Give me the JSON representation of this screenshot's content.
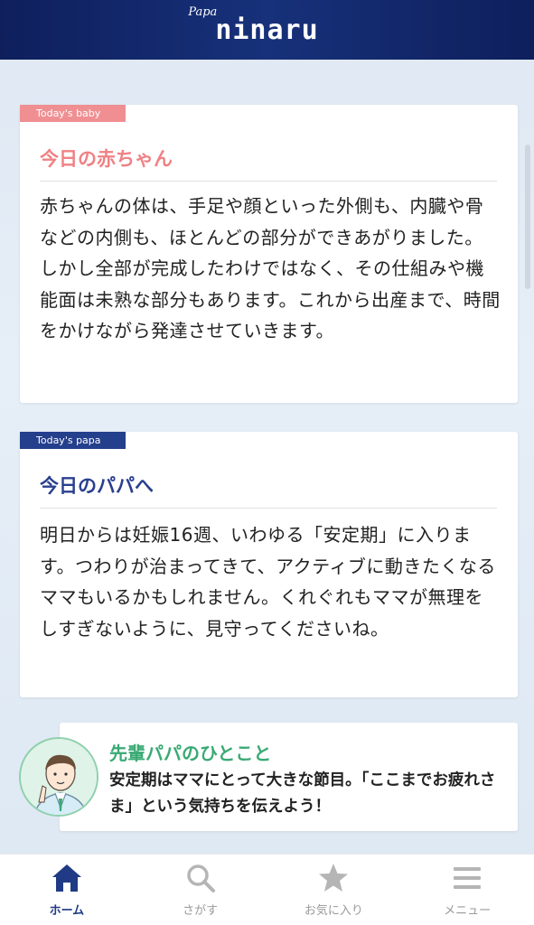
{
  "header": {
    "logo_small": "Papa",
    "logo_main": "ninaru"
  },
  "baby_card": {
    "tag": "Today's baby",
    "title": "今日の赤ちゃん",
    "body": "赤ちゃんの体は、手足や顔といった外側も、内臓や骨などの内側も、ほとんどの部分ができあがりました。しかし全部が完成したわけではなく、その仕組みや機能面は未熟な部分もあります。これから出産まで、時間をかけながら発達させていきます。"
  },
  "papa_card": {
    "tag": "Today's papa",
    "title": "今日のパパへ",
    "body": "明日からは妊娠16週、いわゆる「安定期」に入ります。つわりが治まってきて、アクティブに動きたくなるママもいるかもしれません。くれぐれもママが無理をしすぎないように、見守ってくださいね。"
  },
  "advice": {
    "title": "先輩パパのひとこと",
    "text": "安定期はママにとって大きな節目。「ここまでお疲れさま」という気持ちを伝えよう！"
  },
  "tabs": [
    {
      "label": "ホーム",
      "icon": "home-icon",
      "active": true
    },
    {
      "label": "さがす",
      "icon": "search-icon",
      "active": false
    },
    {
      "label": "お気に入り",
      "icon": "star-icon",
      "active": false
    },
    {
      "label": "メニュー",
      "icon": "menu-icon",
      "active": false
    }
  ],
  "colors": {
    "navy": "#1a2f75",
    "pink": "#f08f92",
    "green": "#3aaa74"
  }
}
